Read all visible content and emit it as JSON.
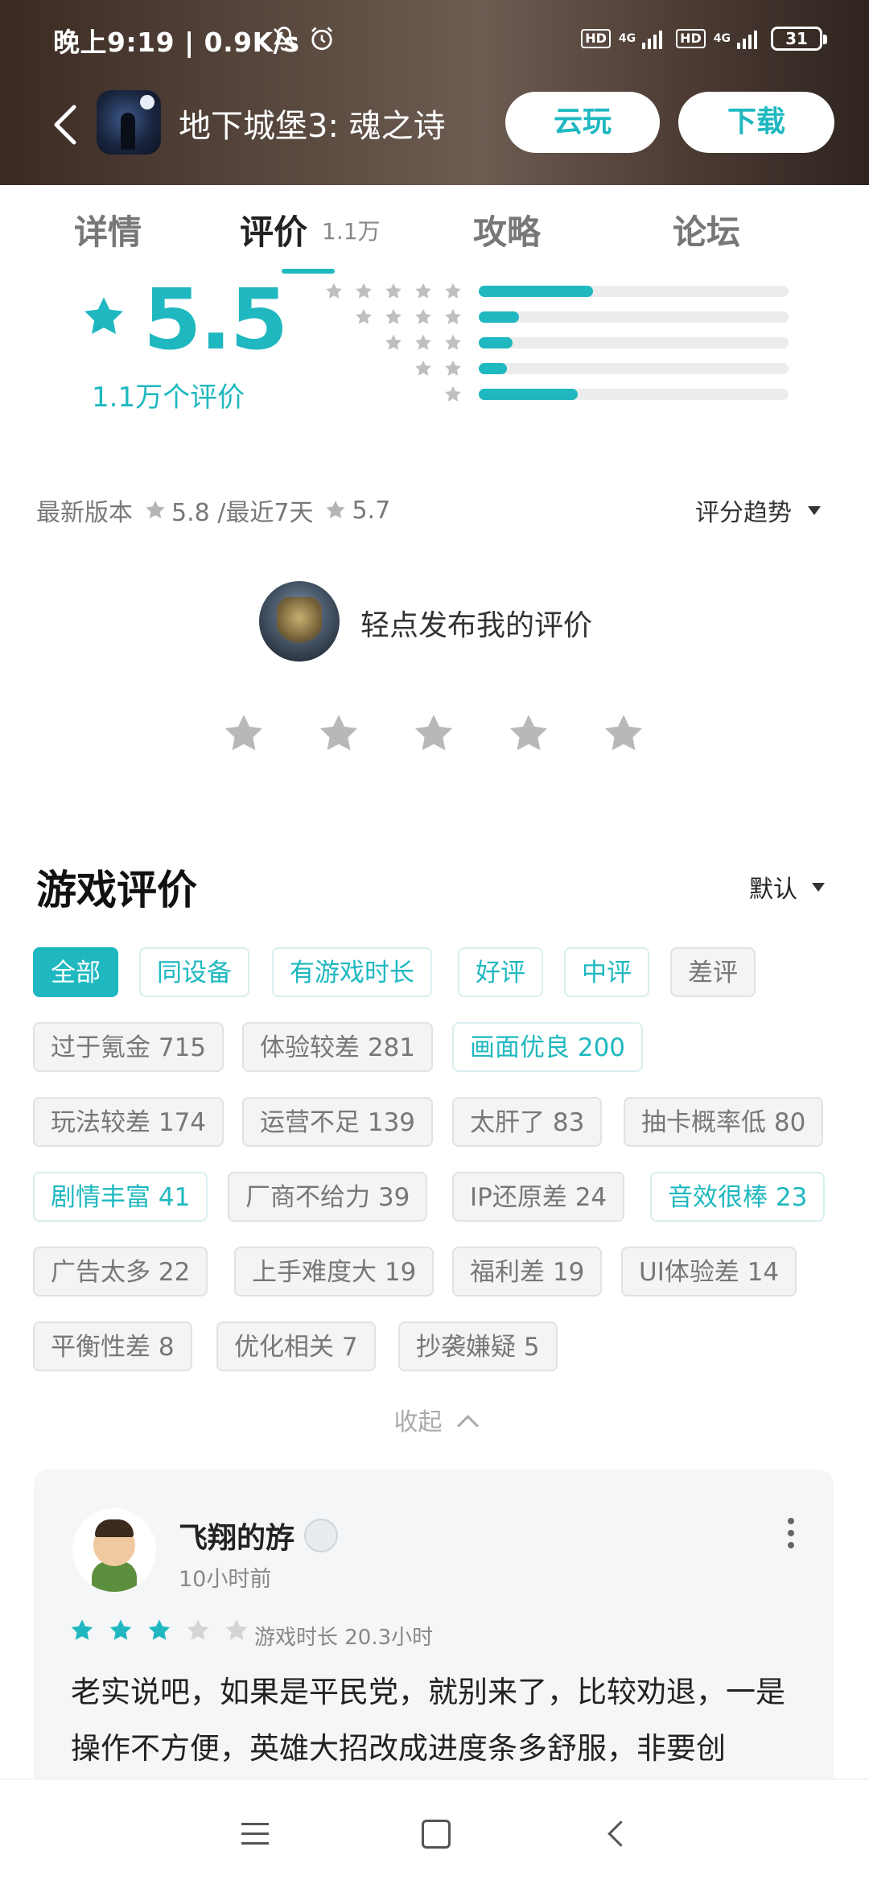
{
  "status_bar": {
    "time": "晚上9:19 | 0.9K/s",
    "hd1": "HD",
    "net1": "4G",
    "hd2": "HD",
    "net2": "4G",
    "battery": "31"
  },
  "header": {
    "title": "地下城堡3: 魂之诗",
    "cloud_play_label": "云玩",
    "download_label": "下载"
  },
  "tabs": [
    {
      "label": "详情"
    },
    {
      "label": "评价",
      "count": "1.1万",
      "active": true
    },
    {
      "label": "攻略"
    },
    {
      "label": "论坛"
    }
  ],
  "rating": {
    "score": "5.5",
    "count_label": "1.1万个评价",
    "distribution": [
      {
        "stars": 5,
        "fraction": 0.37
      },
      {
        "stars": 4,
        "fraction": 0.13
      },
      {
        "stars": 3,
        "fraction": 0.11
      },
      {
        "stars": 2,
        "fraction": 0.09
      },
      {
        "stars": 1,
        "fraction": 0.32
      }
    ]
  },
  "recent": {
    "latest_version_label": "最新版本",
    "latest_version_score": "5.8 /最近7天",
    "last7_score": "5.7",
    "trend_label": "评分趋势"
  },
  "my_review": {
    "prompt": "轻点发布我的评价"
  },
  "reviews_section": {
    "title": "游戏评价",
    "sort_label": "默认",
    "filters": [
      "全部",
      "同设备",
      "有游戏时长",
      "好评",
      "中评",
      "差评"
    ],
    "tags": [
      [
        "过于氪金 715",
        "体验较差 281",
        "画面优良 200"
      ],
      [
        "玩法较差 174",
        "运营不足 139",
        "太肝了 83",
        "抽卡概率低 80"
      ],
      [
        "剧情丰富 41",
        "厂商不给力 39",
        "IP还原差 24",
        "音效很棒 23"
      ],
      [
        "广告太多 22",
        "上手难度大 19",
        "福利差 19",
        "UI体验差 14"
      ],
      [
        "平衡性差 8",
        "优化相关 7",
        "抄袭嫌疑 5"
      ]
    ],
    "collapse_label": "收起"
  },
  "review": {
    "username": "飞翔的斿",
    "time": "10小时前",
    "rating": 3,
    "playtime": "游戏时长 20.3小时",
    "text": "老实说吧，如果是平民党，就别来了，比较劝退，一是操作不方便，英雄大招改成进度条多舒服，非要创"
  },
  "colors": {
    "accent": "#1fb8c0",
    "star_gray": "#bfbfbf"
  }
}
